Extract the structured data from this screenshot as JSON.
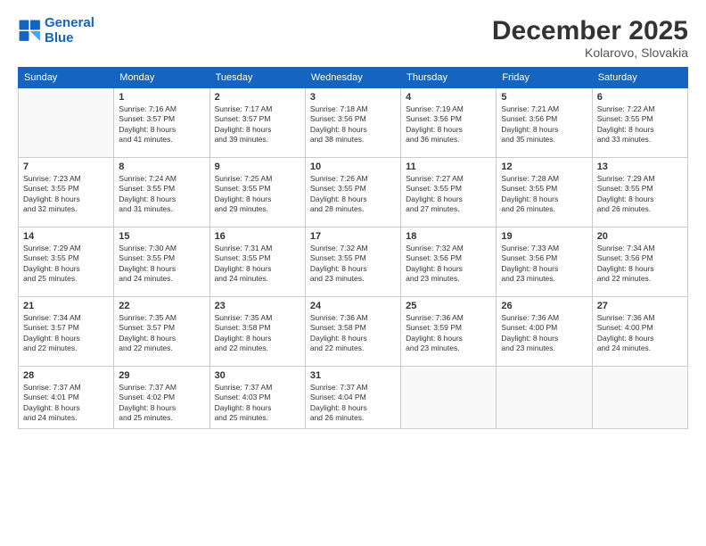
{
  "logo": {
    "line1": "General",
    "line2": "Blue"
  },
  "title": "December 2025",
  "location": "Kolarovo, Slovakia",
  "weekdays": [
    "Sunday",
    "Monday",
    "Tuesday",
    "Wednesday",
    "Thursday",
    "Friday",
    "Saturday"
  ],
  "weeks": [
    [
      {
        "day": "",
        "info": ""
      },
      {
        "day": "1",
        "info": "Sunrise: 7:16 AM\nSunset: 3:57 PM\nDaylight: 8 hours\nand 41 minutes."
      },
      {
        "day": "2",
        "info": "Sunrise: 7:17 AM\nSunset: 3:57 PM\nDaylight: 8 hours\nand 39 minutes."
      },
      {
        "day": "3",
        "info": "Sunrise: 7:18 AM\nSunset: 3:56 PM\nDaylight: 8 hours\nand 38 minutes."
      },
      {
        "day": "4",
        "info": "Sunrise: 7:19 AM\nSunset: 3:56 PM\nDaylight: 8 hours\nand 36 minutes."
      },
      {
        "day": "5",
        "info": "Sunrise: 7:21 AM\nSunset: 3:56 PM\nDaylight: 8 hours\nand 35 minutes."
      },
      {
        "day": "6",
        "info": "Sunrise: 7:22 AM\nSunset: 3:55 PM\nDaylight: 8 hours\nand 33 minutes."
      }
    ],
    [
      {
        "day": "7",
        "info": "Sunrise: 7:23 AM\nSunset: 3:55 PM\nDaylight: 8 hours\nand 32 minutes."
      },
      {
        "day": "8",
        "info": "Sunrise: 7:24 AM\nSunset: 3:55 PM\nDaylight: 8 hours\nand 31 minutes."
      },
      {
        "day": "9",
        "info": "Sunrise: 7:25 AM\nSunset: 3:55 PM\nDaylight: 8 hours\nand 29 minutes."
      },
      {
        "day": "10",
        "info": "Sunrise: 7:26 AM\nSunset: 3:55 PM\nDaylight: 8 hours\nand 28 minutes."
      },
      {
        "day": "11",
        "info": "Sunrise: 7:27 AM\nSunset: 3:55 PM\nDaylight: 8 hours\nand 27 minutes."
      },
      {
        "day": "12",
        "info": "Sunrise: 7:28 AM\nSunset: 3:55 PM\nDaylight: 8 hours\nand 26 minutes."
      },
      {
        "day": "13",
        "info": "Sunrise: 7:29 AM\nSunset: 3:55 PM\nDaylight: 8 hours\nand 26 minutes."
      }
    ],
    [
      {
        "day": "14",
        "info": "Sunrise: 7:29 AM\nSunset: 3:55 PM\nDaylight: 8 hours\nand 25 minutes."
      },
      {
        "day": "15",
        "info": "Sunrise: 7:30 AM\nSunset: 3:55 PM\nDaylight: 8 hours\nand 24 minutes."
      },
      {
        "day": "16",
        "info": "Sunrise: 7:31 AM\nSunset: 3:55 PM\nDaylight: 8 hours\nand 24 minutes."
      },
      {
        "day": "17",
        "info": "Sunrise: 7:32 AM\nSunset: 3:55 PM\nDaylight: 8 hours\nand 23 minutes."
      },
      {
        "day": "18",
        "info": "Sunrise: 7:32 AM\nSunset: 3:56 PM\nDaylight: 8 hours\nand 23 minutes."
      },
      {
        "day": "19",
        "info": "Sunrise: 7:33 AM\nSunset: 3:56 PM\nDaylight: 8 hours\nand 23 minutes."
      },
      {
        "day": "20",
        "info": "Sunrise: 7:34 AM\nSunset: 3:56 PM\nDaylight: 8 hours\nand 22 minutes."
      }
    ],
    [
      {
        "day": "21",
        "info": "Sunrise: 7:34 AM\nSunset: 3:57 PM\nDaylight: 8 hours\nand 22 minutes."
      },
      {
        "day": "22",
        "info": "Sunrise: 7:35 AM\nSunset: 3:57 PM\nDaylight: 8 hours\nand 22 minutes."
      },
      {
        "day": "23",
        "info": "Sunrise: 7:35 AM\nSunset: 3:58 PM\nDaylight: 8 hours\nand 22 minutes."
      },
      {
        "day": "24",
        "info": "Sunrise: 7:36 AM\nSunset: 3:58 PM\nDaylight: 8 hours\nand 22 minutes."
      },
      {
        "day": "25",
        "info": "Sunrise: 7:36 AM\nSunset: 3:59 PM\nDaylight: 8 hours\nand 23 minutes."
      },
      {
        "day": "26",
        "info": "Sunrise: 7:36 AM\nSunset: 4:00 PM\nDaylight: 8 hours\nand 23 minutes."
      },
      {
        "day": "27",
        "info": "Sunrise: 7:36 AM\nSunset: 4:00 PM\nDaylight: 8 hours\nand 24 minutes."
      }
    ],
    [
      {
        "day": "28",
        "info": "Sunrise: 7:37 AM\nSunset: 4:01 PM\nDaylight: 8 hours\nand 24 minutes."
      },
      {
        "day": "29",
        "info": "Sunrise: 7:37 AM\nSunset: 4:02 PM\nDaylight: 8 hours\nand 25 minutes."
      },
      {
        "day": "30",
        "info": "Sunrise: 7:37 AM\nSunset: 4:03 PM\nDaylight: 8 hours\nand 25 minutes."
      },
      {
        "day": "31",
        "info": "Sunrise: 7:37 AM\nSunset: 4:04 PM\nDaylight: 8 hours\nand 26 minutes."
      },
      {
        "day": "",
        "info": ""
      },
      {
        "day": "",
        "info": ""
      },
      {
        "day": "",
        "info": ""
      }
    ]
  ]
}
